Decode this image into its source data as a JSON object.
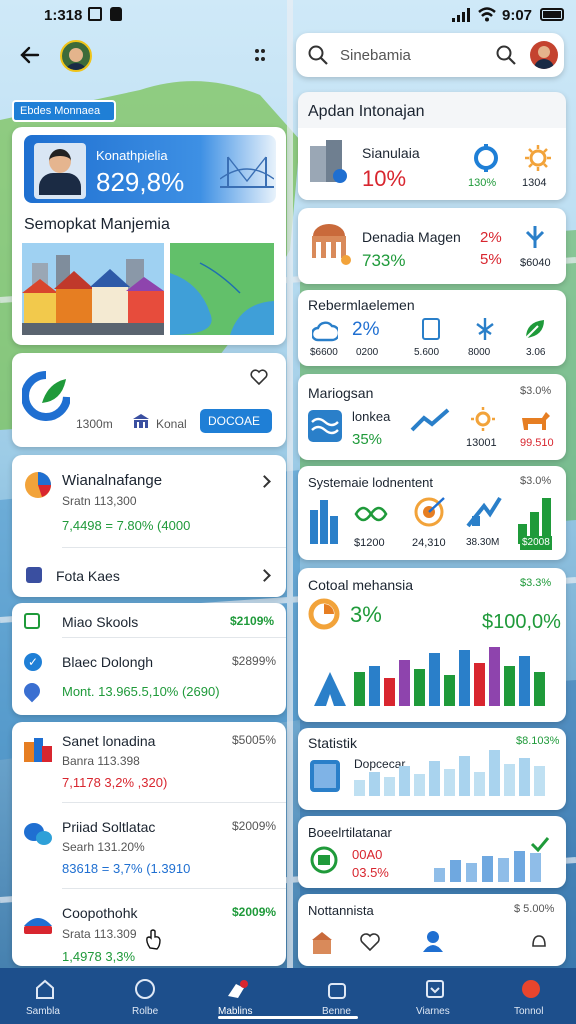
{
  "status": {
    "time": "1:318",
    "right": "9:07"
  },
  "search": {
    "placeholder": "Sinebamia"
  },
  "left": {
    "banner_tag": "Ebdes Monnaea",
    "hero": {
      "label": "Konathpielia",
      "value": "829,8%"
    },
    "section_title": "Semopkat Manjemia",
    "widget": {
      "distance": "1300m",
      "place": "Konal",
      "button": "DOCOAE"
    },
    "list1": [
      {
        "title": "Wianalnafange",
        "sub": "Sratn 113,300",
        "metric": "7,4498 = 7.80% (4000"
      },
      {
        "title": "Fota Kaes"
      }
    ],
    "list2": [
      {
        "title": "Miao Skools",
        "value": "$2109%"
      },
      {
        "title": "Blaec Dolongh",
        "value": "$2899%",
        "metric": "Mont. 13.965.5,10% (2690)"
      }
    ],
    "list3": [
      {
        "title": "Sanet lonadina",
        "value": "$5005%",
        "sub": "Banra 113.398",
        "metric": "7,1178 3,2% ,320)"
      },
      {
        "title": "Priiad Soltlatac",
        "value": "$2009%",
        "sub": "Searh 131.20%",
        "metric": "83618 = 3,7% (1.3910"
      },
      {
        "title": "Coopothohk",
        "value": "$2009%",
        "sub": "Srata 113.309",
        "metric": "1,4978 3,3%"
      }
    ]
  },
  "right": {
    "header": "Apdan Intonajan",
    "c1": {
      "title": "Sianulaia",
      "value": "10%",
      "s1": "130%",
      "s2": "1304"
    },
    "c2": {
      "title": "Denadia Magen",
      "value": "733%",
      "r1": "2%",
      "r2": "5%",
      "r3": "$6040"
    },
    "c3": {
      "title": "Rebermlaelemen",
      "value": "2%",
      "v1": "$6600",
      "v2": "0200",
      "v3": "5.600",
      "v4": "8000",
      "v5": "3.06"
    },
    "c4": {
      "title": "Mariogsan",
      "topval": "$3.0%",
      "sub": "lonkea",
      "value": "35%",
      "v1": "13001",
      "v2": "99.510"
    },
    "c5": {
      "title": "Systemaie lodnentent",
      "topval": "$3.0%",
      "v1": "$1200",
      "v2": "24,310",
      "v3": "38.30M",
      "v4": "$2008"
    },
    "c6": {
      "title": "Cotoal mehansia",
      "topval": "$3.3%",
      "value": "3%",
      "big": "$100,0%"
    },
    "c7": {
      "title": "Statistik",
      "topval": "$8.103%",
      "sub": "Dopcecar"
    },
    "c8": {
      "title": "Boeelrtilatanar",
      "v1": "00A0",
      "v2": "03.5%"
    },
    "c9": {
      "title": "Nottannista",
      "topval": "$ 5.00%"
    }
  },
  "nav": [
    "Sambla",
    "Rolbe",
    "Mablins",
    "Benne",
    "Viarnes",
    "Tonnol"
  ],
  "colors": {
    "accent": "#1f6fd1",
    "green": "#1f9a3a",
    "red": "#d8262f",
    "nav": "#1d4f8c"
  }
}
